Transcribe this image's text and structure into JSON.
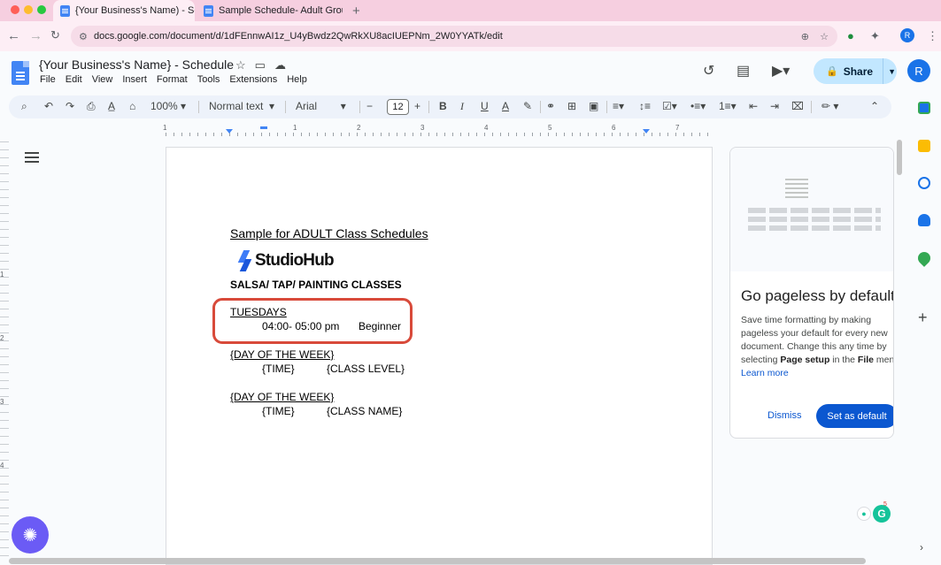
{
  "browser": {
    "tabs": [
      {
        "title": "{Your Business's Name) - Sch",
        "active": true
      },
      {
        "title": "Sample Schedule- Adult Grou",
        "active": false
      }
    ],
    "new_tab_icon": "+",
    "url": "docs.google.com/document/d/1dFEnnwAI1z_U4yBwdz2QwRkXU8acIUEPNm_2W0YYATk/edit",
    "profile_initial": "R"
  },
  "docs": {
    "title": "{Your Business's Name} - Schedule",
    "menu": [
      "File",
      "Edit",
      "View",
      "Insert",
      "Format",
      "Tools",
      "Extensions",
      "Help"
    ],
    "share_label": "Share",
    "avatar_initial": "R"
  },
  "toolbar": {
    "zoom": "100%",
    "style": "Normal text",
    "font": "Arial",
    "font_size": "12"
  },
  "ruler": {
    "numbers": [
      "1",
      "1",
      "2",
      "3",
      "4",
      "5",
      "6",
      "7"
    ],
    "vertical_numbers": [
      "1",
      "2",
      "3",
      "4"
    ]
  },
  "document": {
    "heading": "Sample for ADULT Class Schedules",
    "logo_text": "StudioHub",
    "classes_title": "SALSA/ TAP/ PAINTING CLASSES",
    "entries": [
      {
        "day": "TUESDAYS",
        "time": "04:00- 05:00 pm",
        "detail": "Beginner"
      },
      {
        "day": "{DAY OF THE WEEK}",
        "time": "{TIME}",
        "detail": "{CLASS LEVEL}"
      },
      {
        "day": "{DAY OF THE WEEK}",
        "time": "{TIME}",
        "detail": "{CLASS NAME}"
      }
    ]
  },
  "side_panel": {
    "title": "Go pageless by default",
    "body_1": "Save time formatting by making pageless your default for every new document. Change this any time by selecting ",
    "body_bold_1": "Page setup",
    "body_2": " in the ",
    "body_bold_2": "File",
    "body_3": " menu",
    "link": "Learn more",
    "dismiss": "Dismiss",
    "set_default": "Set as default"
  },
  "grammarly_count": "5",
  "colors": {
    "tab_strip": "#f6cfe0",
    "accent": "#0b57d0",
    "share_bg": "#c2e7ff",
    "highlight_box": "#d84a3a",
    "fab": "#6b5bf5"
  }
}
